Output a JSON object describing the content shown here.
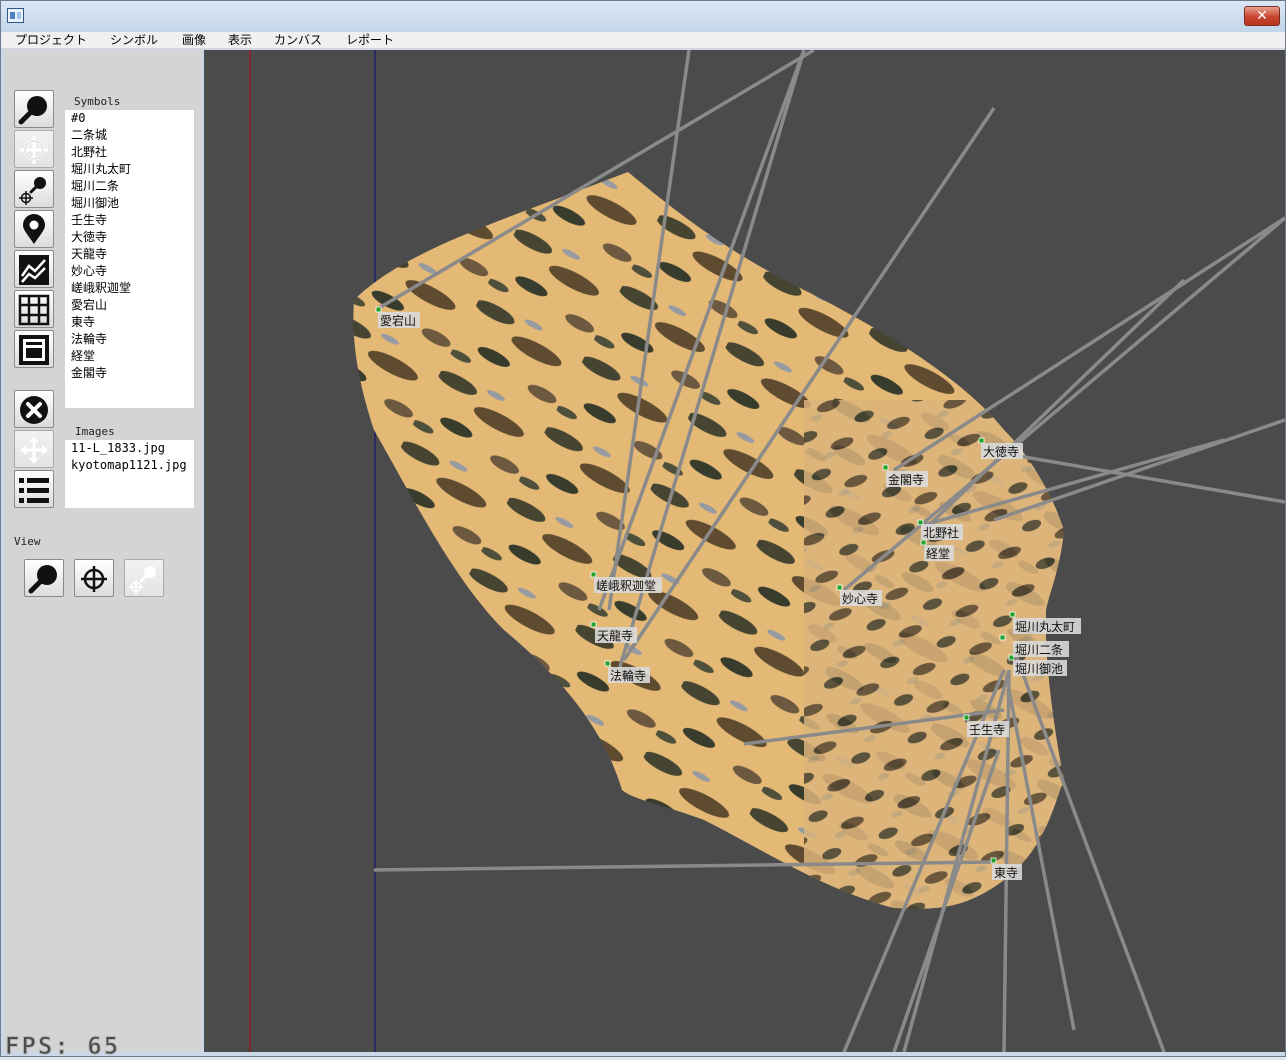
{
  "window": {
    "title": "",
    "close_glyph": "✕"
  },
  "menu": [
    {
      "label": "プロジェクト"
    },
    {
      "label": "シンボル"
    },
    {
      "label": "画像"
    },
    {
      "label": "表示"
    },
    {
      "label": "カンバス"
    },
    {
      "label": "レポート"
    }
  ],
  "tools": [
    {
      "icon": "magnifier-icon",
      "enabled": true
    },
    {
      "icon": "crosshair-icon",
      "enabled": false
    },
    {
      "icon": "crosshair-magnifier-icon",
      "enabled": true
    },
    {
      "icon": "map-pin-icon",
      "enabled": true
    },
    {
      "icon": "line-chart-icon",
      "enabled": true
    },
    {
      "icon": "grid-icon",
      "enabled": true
    },
    {
      "icon": "layout-icon",
      "enabled": true
    },
    {
      "icon": "close-circle-icon",
      "enabled": true
    },
    {
      "icon": "move-arrows-icon",
      "enabled": false
    },
    {
      "icon": "list-icon",
      "enabled": true
    }
  ],
  "symbols": {
    "label": "Symbols",
    "items": [
      "#0",
      "二条城",
      "北野社",
      "堀川丸太町",
      "堀川二条",
      "堀川御池",
      "壬生寺",
      "大徳寺",
      "天龍寺",
      "妙心寺",
      "嵯峨釈迦堂",
      "愛宕山",
      "東寺",
      "法輪寺",
      "経堂",
      "金閣寺"
    ]
  },
  "images": {
    "label": "Images",
    "items": [
      "11-L_1833.jpg",
      "kyotomap1121.jpg"
    ]
  },
  "view": {
    "label": "View",
    "buttons": [
      {
        "icon": "magnifier-icon",
        "enabled": true
      },
      {
        "icon": "crosshair-icon",
        "enabled": true
      },
      {
        "icon": "crosshair-magnifier-icon",
        "enabled": false
      }
    ]
  },
  "canvas": {
    "background": "#4b4b4b",
    "marker_color": "#1fa32a",
    "line_color": "#8a8a8a",
    "map_labels": [
      "愛宕山",
      "金閣寺",
      "大徳寺",
      "北野社",
      "経堂",
      "妙心寺",
      "嵯峨釈迦堂",
      "天龍寺",
      "法輪寺",
      "堀川丸太町",
      "堀川二条",
      "堀川御池",
      "壬生寺",
      "東寺"
    ]
  },
  "status": {
    "fps": "FPS: 65"
  }
}
